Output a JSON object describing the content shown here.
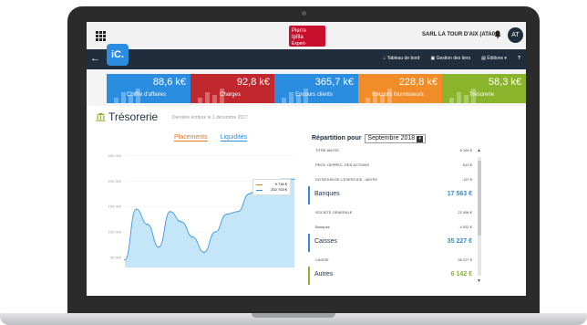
{
  "topbar": {
    "brand": {
      "line1": "Pierre",
      "line2": "Ipfila",
      "line3": "Expert-comptable"
    },
    "company": "SARL LA TOUR D'AIX (ATA00)",
    "avatar_initials": "AT"
  },
  "nav": {
    "logo": "iC.",
    "items": [
      {
        "icon": "home-icon",
        "label": "Tableau de bord"
      },
      {
        "icon": "folder-icon",
        "label": "Gestion des tiers"
      },
      {
        "icon": "document-icon",
        "label": "Éditions ▾"
      }
    ]
  },
  "kpis": [
    {
      "value": "88,6 k€",
      "label": "Chiffre d'affaires",
      "color": "#2a8de0"
    },
    {
      "value": "92,8 k€",
      "label": "Charges",
      "color": "#c0282e"
    },
    {
      "value": "365,7 k€",
      "label": "Encours clients",
      "color": "#2a8de0"
    },
    {
      "value": "228,8 k€",
      "label": "Encours fournisseurs",
      "color": "#f28c28"
    },
    {
      "value": "58,3 k€",
      "label": "Trésorerie",
      "color": "#8ab42b"
    }
  ],
  "tresorerie": {
    "title": "Trésorerie",
    "subtitle": "Dernière écriture le 1 décembre 2017",
    "tabs": [
      "Placements",
      "Liquidités"
    ],
    "tooltip": [
      {
        "color": "#e5762a",
        "value": "9 716 €"
      },
      {
        "color": "#2a8de0",
        "value": "202 703 €"
      }
    ]
  },
  "chart_data": {
    "type": "area",
    "title": "",
    "xlabel": "",
    "ylabel": "",
    "ylim": [
      30000,
      260000
    ],
    "yticks": [
      "250 000",
      "200 000",
      "150 000",
      "100 000",
      "50 000"
    ],
    "series": [
      {
        "name": "Liquidités",
        "color": "#2a8de0",
        "values": [
          45000,
          145000,
          115000,
          70000,
          140000,
          120000,
          90000,
          60000,
          100000,
          135000,
          140000,
          175000,
          200000,
          203000,
          204000,
          204000
        ]
      }
    ]
  },
  "repartition": {
    "label": "Répartition pour",
    "period": "Septembre 2018",
    "rows": [
      {
        "type": "item",
        "label": "TITRE ABYSS",
        "amount": "6 154 €"
      },
      {
        "type": "item",
        "label": "PROV. DEPREC. DES ACTIONS",
        "amount": "-510 €"
      },
      {
        "type": "item",
        "label": "DOTATION DE L'EXERCICE - ABYSS",
        "amount": "-137 €"
      },
      {
        "type": "group",
        "label": "Banques",
        "amount": "17 563 €",
        "color": "blue"
      },
      {
        "type": "item",
        "label": "SOCIETE GENERALE",
        "amount": "22 496 €"
      },
      {
        "type": "item",
        "label": "Banques",
        "amount": "-4 932 €"
      },
      {
        "type": "group",
        "label": "Caisses",
        "amount": "35 227 €",
        "color": "blue"
      },
      {
        "type": "item",
        "label": "CAISSE",
        "amount": "35 227 €"
      },
      {
        "type": "group",
        "label": "Autres",
        "amount": "6 142 €",
        "color": "green"
      }
    ]
  }
}
